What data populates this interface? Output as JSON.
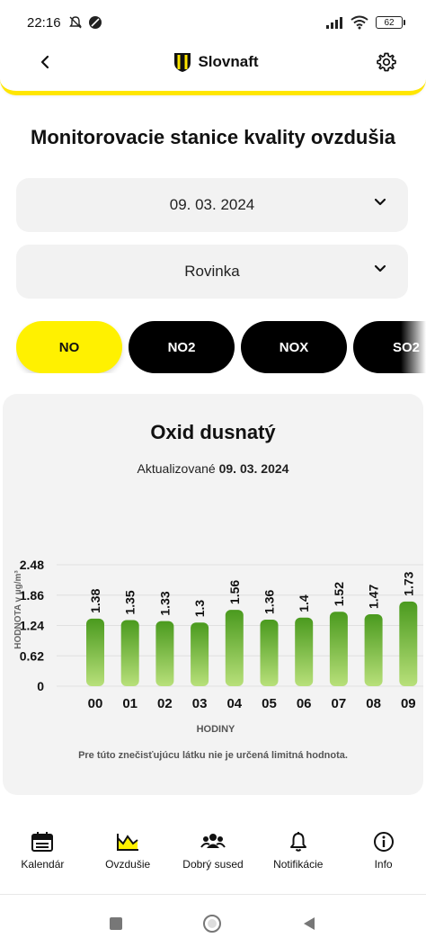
{
  "status": {
    "time": "22:16",
    "battery": "62"
  },
  "header": {
    "brand": "Slovnaft"
  },
  "page_title": "Monitorovacie stanice kvality ovzdušia",
  "date_select": {
    "value": "09. 03. 2024"
  },
  "station_select": {
    "value": "Rovinka"
  },
  "pollutant_tabs": [
    {
      "label": "NO",
      "active": true
    },
    {
      "label": "NO2",
      "active": false
    },
    {
      "label": "NOX",
      "active": false
    },
    {
      "label": "SO2",
      "active": false
    }
  ],
  "card": {
    "title": "Oxid dusnatý",
    "updated_prefix": "Aktualizované",
    "updated_date": "09. 03. 2024",
    "note": "Pre túto znečisťujúcu látku nie je určená limitná hodnota."
  },
  "chart_data": {
    "type": "bar",
    "categories": [
      "00",
      "01",
      "02",
      "03",
      "04",
      "05",
      "06",
      "07",
      "08",
      "09"
    ],
    "values": [
      1.38,
      1.35,
      1.33,
      1.3,
      1.56,
      1.36,
      1.4,
      1.52,
      1.47,
      1.73
    ],
    "value_labels": [
      "1.38",
      "1.35",
      "1.33",
      "1.3",
      "1.56",
      "1.36",
      "1.4",
      "1.52",
      "1.47",
      "1.73"
    ],
    "xlabel": "HODINY",
    "ylabel": "HODNOTA v µg/m³",
    "yticks": [
      "2.48",
      "1.86",
      "1.24",
      "0.62",
      "0"
    ],
    "ylim": [
      0,
      2.48
    ],
    "bar_color_top": "#4a9a1e",
    "bar_color_bottom": "#b8e07a",
    "grid": true
  },
  "bottom_nav": [
    {
      "label": "Kalendár",
      "icon": "calendar-icon"
    },
    {
      "label": "Ovzdušie",
      "icon": "chart-icon"
    },
    {
      "label": "Dobrý sused",
      "icon": "people-icon"
    },
    {
      "label": "Notifikácie",
      "icon": "bell-icon"
    },
    {
      "label": "Info",
      "icon": "info-icon"
    }
  ],
  "colors": {
    "accent": "#fff100",
    "header_border": "#ffe600"
  }
}
